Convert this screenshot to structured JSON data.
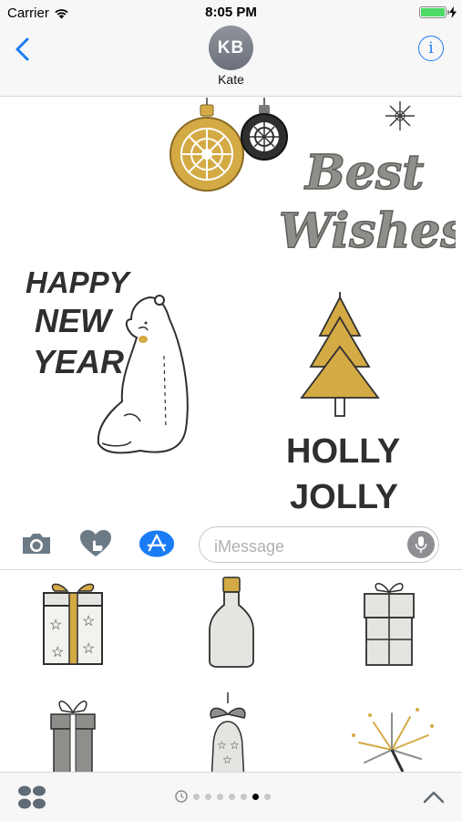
{
  "status_bar": {
    "carrier": "Carrier",
    "time": "8:05 PM",
    "battery_level": 1.0
  },
  "header": {
    "back_icon": "chevron-left-icon",
    "avatar_initials": "KB",
    "contact_name": "Kate",
    "info_icon": "info-icon",
    "accent_color": "#1a7cf5"
  },
  "conversation": {
    "stickers": [
      {
        "name": "ornaments-sticker",
        "kind": "christmas ornaments"
      },
      {
        "name": "best-wishes-sticker",
        "text": "Best Wishes"
      },
      {
        "name": "happy-new-year-sticker",
        "text": "HAPPY NEW YEAR"
      },
      {
        "name": "polar-bear-sticker",
        "kind": "polar bear"
      },
      {
        "name": "christmas-tree-sticker",
        "kind": "christmas tree"
      },
      {
        "name": "holly-jolly-sticker",
        "text": "HOLLY JOLLY"
      }
    ]
  },
  "input_bar": {
    "camera_icon": "camera-icon",
    "digital_touch_icon": "digital-touch-icon",
    "app_store_icon": "app-store-icon",
    "placeholder": "iMessage",
    "mic_icon": "microphone-icon"
  },
  "drawer": {
    "items": [
      {
        "name": "gift-box-stars-sticker"
      },
      {
        "name": "bottle-sticker"
      },
      {
        "name": "gift-box-ribbon-sticker"
      },
      {
        "name": "gift-box-bow-sticker"
      },
      {
        "name": "bell-sticker"
      },
      {
        "name": "fireworks-sticker"
      }
    ]
  },
  "bottom_bar": {
    "drawer_icon": "app-drawer-icon",
    "recents_icon": "clock-icon",
    "page_count": 7,
    "active_page": 6,
    "expand_icon": "chevron-up-icon"
  },
  "colors": {
    "gold": "#d4aa45",
    "dark": "#3a3a3a",
    "gray": "#8d8f8a",
    "light_gray": "#e4e4e0"
  }
}
